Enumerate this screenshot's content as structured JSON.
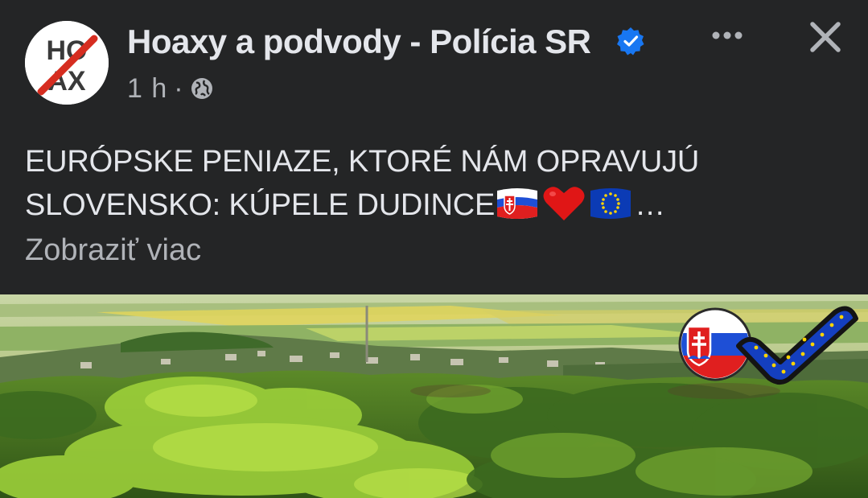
{
  "post": {
    "page_name": "Hoaxy a podvody - Polícia SR",
    "verified": true,
    "timestamp": "1 h",
    "separator": "·",
    "audience_icon": "globe-icon",
    "more_icon": "more-dots-icon",
    "close_icon": "close-icon",
    "avatar": {
      "logo_text_top": "HO",
      "logo_text_bottom": "AX"
    },
    "text_line_1": "EURÓPSKE PENIAZE, KTORÉ NÁM OPRAVUJÚ",
    "text_line_2": "SLOVENSKO: KÚPELE DUDINCE",
    "text_ellipsis": "…",
    "emojis": [
      "slovakia-flag-icon",
      "red-heart-icon",
      "eu-flag-icon"
    ],
    "see_more_label": "Zobraziť viac"
  },
  "image": {
    "description_icons": [
      "slovakia-round-flag-icon",
      "eu-checkmark-icon"
    ]
  },
  "colors": {
    "background": "#242526",
    "primary_text": "#e4e6eb",
    "secondary_text": "#b0b3b8",
    "verified_blue": "#1877f2",
    "hoax_red": "#d62d20"
  }
}
